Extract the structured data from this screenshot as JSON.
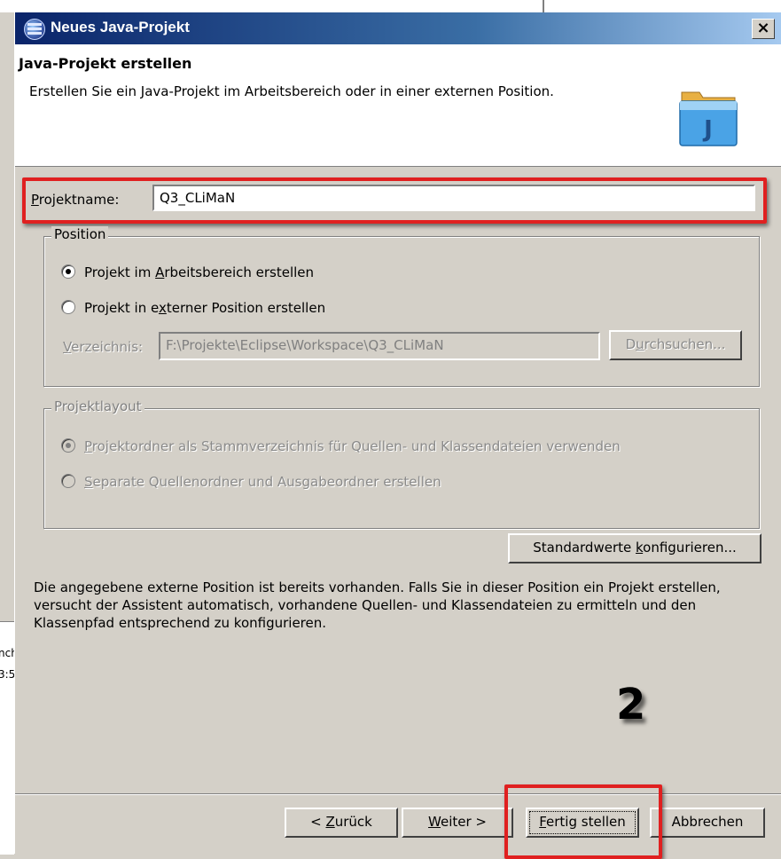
{
  "dialog": {
    "title": "Neues Java-Projekt",
    "close_label": "×"
  },
  "header": {
    "title": "Java-Projekt erstellen",
    "description": "Erstellen Sie ein Java-Projekt im Arbeitsbereich oder in einer externen Position."
  },
  "project_name": {
    "label_mnemonic": "P",
    "label_rest": "rojektname:",
    "value": "Q3_CLiMaN"
  },
  "position": {
    "legend": "Position",
    "option_workspace": {
      "pre": "Projekt im ",
      "mn": "A",
      "post": "rbeitsbereich erstellen",
      "checked": true
    },
    "option_external": {
      "pre": "Projekt in e",
      "mn": "x",
      "post": "terner Position erstellen",
      "checked": false
    },
    "directory_label_mn": "V",
    "directory_label_rest": "erzeichnis:",
    "directory_value": "F:\\Projekte\\Eclipse\\Workspace\\Q3_CLiMaN",
    "browse_pre": "D",
    "browse_mn": "u",
    "browse_post": "rchsuchen..."
  },
  "layout": {
    "legend": "Projektlayout",
    "option_single": {
      "mn": "P",
      "rest": "rojektordner als Stammverzeichnis für Quellen- und Klassendateien verwenden",
      "checked": true
    },
    "option_separate": {
      "mn": "S",
      "rest": "eparate Quellenordner und Ausgabeordner erstellen",
      "checked": false
    }
  },
  "configure_defaults": {
    "pre": "Standardwerte ",
    "mn": "k",
    "post": "onfigurieren..."
  },
  "info_text": "Die angegebene externe Position ist bereits vorhanden. Falls Sie in dieser Position ein Projekt erstellen, versucht der Assistent automatisch, vorhandene Quellen- und Klassendateien zu ermitteln und den Klassenpfad entsprechend zu konfigurieren.",
  "annotation": "2",
  "buttons": {
    "back": {
      "pre": "< ",
      "mn": "Z",
      "post": "urück"
    },
    "next": {
      "mn": "W",
      "post": "eiter >"
    },
    "finish": {
      "mn": "F",
      "post": "ertig stellen"
    },
    "cancel": "Abbrechen"
  },
  "background": {
    "left_text_1": "nch",
    "left_text_2": "3:5"
  },
  "colors": {
    "highlight": "#e02020",
    "titlebar_start": "#0a246a",
    "titlebar_end": "#a6caf0"
  }
}
